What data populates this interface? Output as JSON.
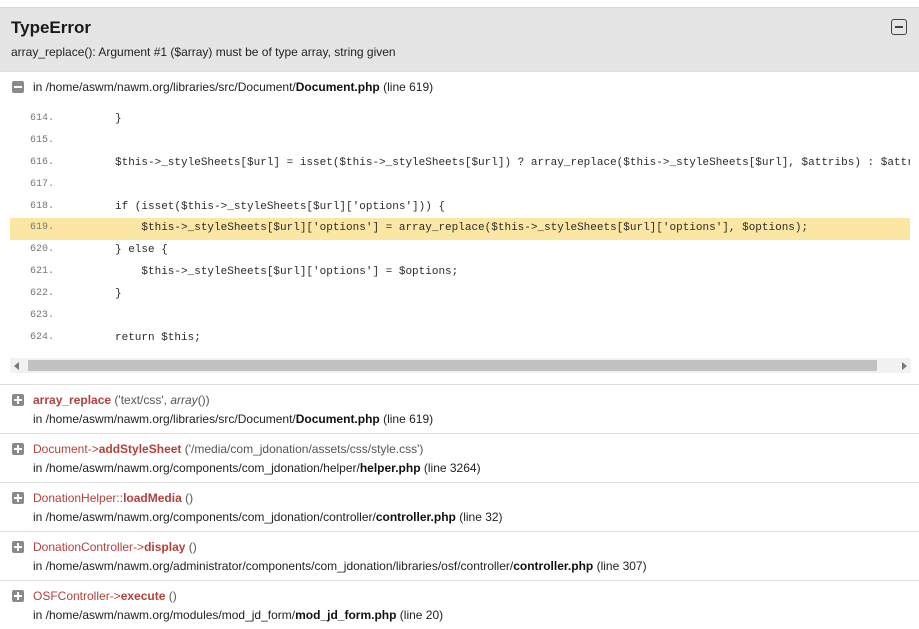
{
  "error": {
    "type": "TypeError",
    "message": "array_replace(): Argument #1 ($array) must be of type array, string given"
  },
  "frame": {
    "location_prefix": "in /home/aswm/nawm.org/libraries/src/Document/",
    "file": "Document.php",
    "line_suffix": "(line 619)"
  },
  "code": [
    {
      "n": "614.",
      "text": "        }"
    },
    {
      "n": "615.",
      "text": ""
    },
    {
      "n": "616.",
      "text": "        $this->_styleSheets[$url] = isset($this->_styleSheets[$url]) ? array_replace($this->_styleSheets[$url], $attribs) : $attribs;"
    },
    {
      "n": "617.",
      "text": ""
    },
    {
      "n": "618.",
      "text": "        if (isset($this->_styleSheets[$url]['options'])) {"
    },
    {
      "n": "619.",
      "text": "            $this->_styleSheets[$url]['options'] = array_replace($this->_styleSheets[$url]['options'], $options);"
    },
    {
      "n": "620.",
      "text": "        } else {"
    },
    {
      "n": "621.",
      "text": "            $this->_styleSheets[$url]['options'] = $options;"
    },
    {
      "n": "622.",
      "text": "        }"
    },
    {
      "n": "623.",
      "text": ""
    },
    {
      "n": "624.",
      "text": "        return $this;"
    }
  ],
  "highlighted_line": "619.",
  "trace": [
    {
      "cls": "",
      "op": "",
      "fn": "array_replace",
      "args_pre": " ('text/css', ",
      "args_italic": "array",
      "args_post": "())",
      "loc_prefix": "in /home/aswm/nawm.org/libraries/src/Document/",
      "file": "Document.php",
      "line": "(line 619)"
    },
    {
      "cls": "Document",
      "op": "->",
      "fn": "addStyleSheet",
      "args_pre": " ('/media/com_jdonation/assets/css/style.css')",
      "args_italic": "",
      "args_post": "",
      "loc_prefix": "in /home/aswm/nawm.org/components/com_jdonation/helper/",
      "file": "helper.php",
      "line": "(line 3264)"
    },
    {
      "cls": "DonationHelper",
      "op": "::",
      "fn": "loadMedia",
      "args_pre": " ()",
      "args_italic": "",
      "args_post": "",
      "loc_prefix": "in /home/aswm/nawm.org/components/com_jdonation/controller/",
      "file": "controller.php",
      "line": "(line 32)"
    },
    {
      "cls": "DonationController",
      "op": "->",
      "fn": "display",
      "args_pre": " ()",
      "args_italic": "",
      "args_post": "",
      "loc_prefix": "in /home/aswm/nawm.org/administrator/components/com_jdonation/libraries/osf/controller/",
      "file": "controller.php",
      "line": "(line 307)"
    },
    {
      "cls": "OSFController",
      "op": "->",
      "fn": "execute",
      "args_pre": " ()",
      "args_italic": "",
      "args_post": "",
      "loc_prefix": "in /home/aswm/nawm.org/modules/mod_jd_form/",
      "file": "mod_jd_form.php",
      "line": "(line 20)"
    }
  ],
  "icons": {
    "collapse": "minus-square-icon",
    "expand": "plus-square-icon"
  },
  "colors": {
    "header_bg": "#e5e5e5",
    "highlight": "#fbe7a3",
    "accent": "#b5403a"
  }
}
